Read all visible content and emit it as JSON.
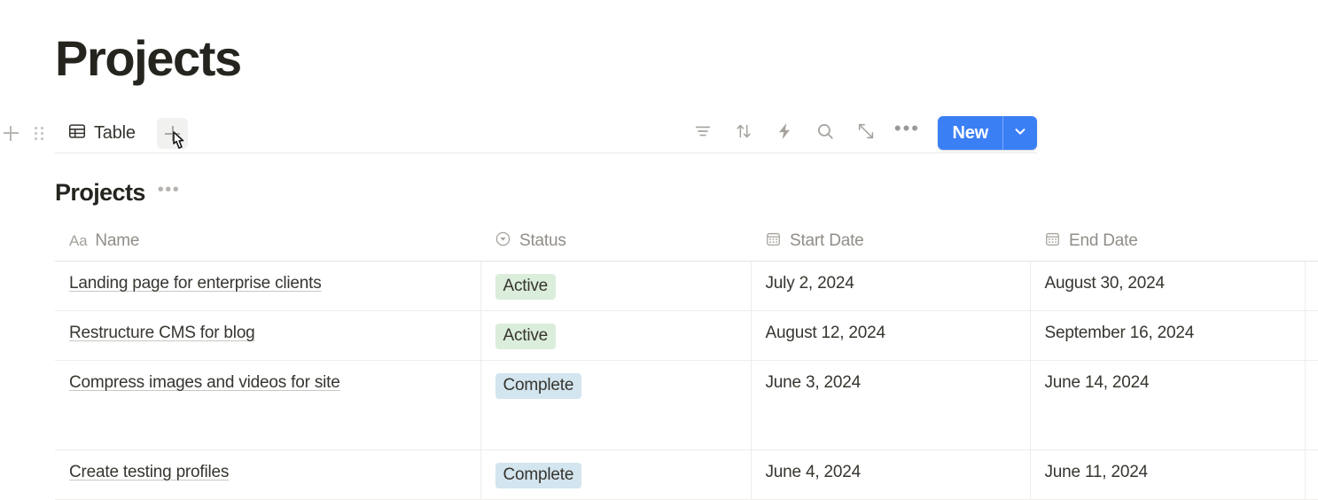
{
  "page": {
    "title": "Projects"
  },
  "toolbar": {
    "add_block_icon": "plus-icon",
    "drag_handle_icon": "drag-handle-icon",
    "view_tab": {
      "icon": "table-icon",
      "label": "Table"
    },
    "add_view_label": "+",
    "icons": [
      {
        "name": "filter-icon",
        "glyph": "filter"
      },
      {
        "name": "sort-icon",
        "glyph": "sort"
      },
      {
        "name": "automation-lightning-icon",
        "glyph": "bolt"
      },
      {
        "name": "search-icon",
        "glyph": "search"
      },
      {
        "name": "expand-icon",
        "glyph": "expand"
      },
      {
        "name": "more-options-icon",
        "glyph": "ellipsis"
      }
    ],
    "more_label": "•••",
    "new_button": {
      "label": "New",
      "caret_icon": "chevron-down-icon",
      "color": "#3b7ff5"
    }
  },
  "database": {
    "title": "Projects",
    "options_label": "•••",
    "columns": [
      {
        "label": "Name",
        "icon": "title-text-icon",
        "icon_text": "Aa"
      },
      {
        "label": "Status",
        "icon": "select-circle-icon",
        "icon_text": ""
      },
      {
        "label": "Start Date",
        "icon": "calendar-icon",
        "icon_text": ""
      },
      {
        "label": "End Date",
        "icon": "calendar-icon",
        "icon_text": ""
      }
    ],
    "rows": [
      {
        "name": "Landing page for enterprise clients",
        "status": "Active",
        "status_color": "#dbeddb",
        "start_date": "July 2, 2024",
        "end_date": "August 30, 2024",
        "tall": false
      },
      {
        "name": "Restructure CMS for blog",
        "status": "Active",
        "status_color": "#dbeddb",
        "start_date": "August 12, 2024",
        "end_date": "September 16, 2024",
        "tall": false
      },
      {
        "name": "Compress images and videos for site",
        "status": "Complete",
        "status_color": "#d3e5ef",
        "start_date": "June 3, 2024",
        "end_date": "June 14, 2024",
        "tall": true
      },
      {
        "name": "Create testing profiles",
        "status": "Complete",
        "status_color": "#d3e5ef",
        "start_date": "June 4, 2024",
        "end_date": "June 11, 2024",
        "tall": false
      }
    ]
  }
}
